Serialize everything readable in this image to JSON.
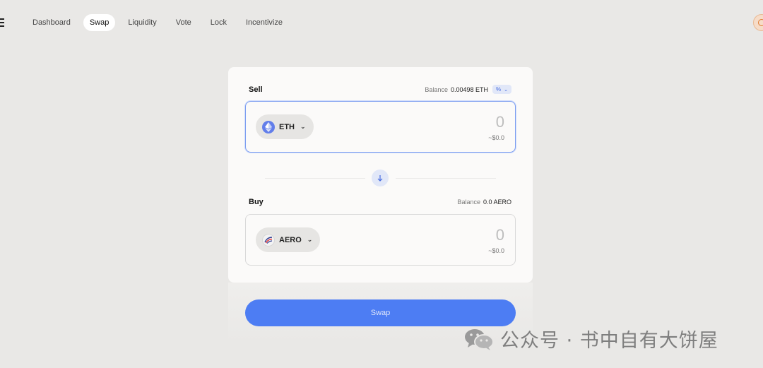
{
  "nav": {
    "items": [
      {
        "label": "Dashboard",
        "active": false
      },
      {
        "label": "Swap",
        "active": true
      },
      {
        "label": "Liquidity",
        "active": false
      },
      {
        "label": "Vote",
        "active": false
      },
      {
        "label": "Lock",
        "active": false
      },
      {
        "label": "Incentivize",
        "active": false
      }
    ],
    "menu_icon": "hamburger-menu-icon",
    "avatar_icon": "wallet-avatar-icon"
  },
  "swap": {
    "sell": {
      "title": "Sell",
      "balance_label": "Balance",
      "balance_value": "0.00498 ETH",
      "percent_label": "%",
      "token": "ETH",
      "token_icon": "ethereum-icon",
      "amount": "0",
      "usd_value": "~$0.0"
    },
    "direction_icon": "arrow-down-icon",
    "buy": {
      "title": "Buy",
      "balance_label": "Balance",
      "balance_value": "0.0 AERO",
      "token": "AERO",
      "token_icon": "aero-icon",
      "amount": "0",
      "usd_value": "~$0.0"
    },
    "button_label": "Swap"
  },
  "watermark": {
    "icon": "wechat-icon",
    "text": "公众号 · 书中自有大饼屋"
  },
  "colors": {
    "accent": "#4d7df3",
    "background": "#e9e8e6",
    "card": "#fbfaf9"
  }
}
